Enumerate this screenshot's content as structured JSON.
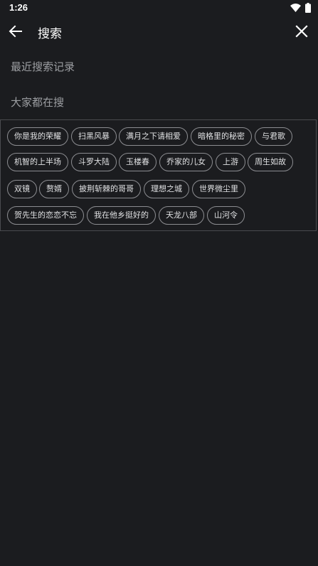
{
  "status_bar": {
    "time": "1:26",
    "icons": [
      "wifi-icon",
      "battery-icon"
    ]
  },
  "toolbar": {
    "title": "搜索",
    "back_icon": "arrow-left-icon",
    "close_icon": "close-icon"
  },
  "sections": {
    "recent": "最近搜索记录",
    "hot": "大家都在搜"
  },
  "hot_tags": [
    [
      "你是我的荣耀",
      "扫黑风暴",
      "满月之下请相爱",
      "暗格里的秘密",
      "与君歌"
    ],
    [
      "机智的上半场",
      "斗罗大陆",
      "玉楼春",
      "乔家的儿女",
      "上游",
      "周生如故"
    ],
    [
      "双镜",
      "赘婿",
      "披荆斩棘的哥哥",
      "理想之城",
      "世界微尘里"
    ],
    [
      "贺先生的恋恋不忘",
      "我在他乡挺好的",
      "天龙八部",
      "山河令"
    ]
  ],
  "colors": {
    "background": "#1b1c1f",
    "section_label": "#9c9ea2",
    "tag_border": "#8c8d91",
    "tag_text": "#e0e1e3",
    "panel_border": "#4a4b4f"
  }
}
